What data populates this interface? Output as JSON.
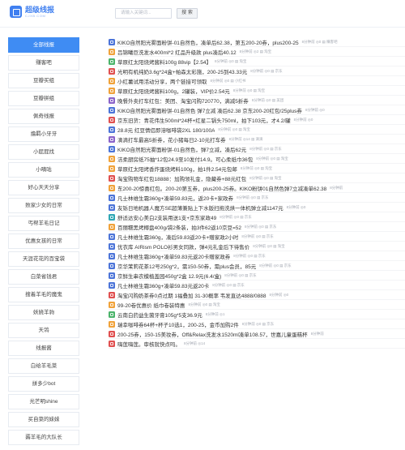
{
  "header": {
    "logo_title": "超级线报",
    "logo_sub": "CJXB.COM",
    "search_placeholder": "请输入关键词...",
    "search_button": "搜 索"
  },
  "sidebar": {
    "items": [
      {
        "label": "全部线报",
        "active": true
      },
      {
        "label": "赚客吧"
      },
      {
        "label": "豆瓣买组"
      },
      {
        "label": "豆瓣拼组"
      },
      {
        "label": "佩奇线报"
      },
      {
        "label": "撸羁小牙牙"
      },
      {
        "label": "小屁屁找"
      },
      {
        "label": "小嘀咕"
      },
      {
        "label": "好心天天分享"
      },
      {
        "label": "败家少女的日常"
      },
      {
        "label": "丐帮羊毛日记"
      },
      {
        "label": "优惠女孩的日常"
      },
      {
        "label": "天涯花花的百宝袋"
      },
      {
        "label": "白菜省钱君"
      },
      {
        "label": "搜着羊毛的魔鬼"
      },
      {
        "label": "妖娆羊驹"
      },
      {
        "label": "天鸰"
      },
      {
        "label": "线报酱"
      },
      {
        "label": "白给羊毛菜"
      },
      {
        "label": "拼多少bot"
      },
      {
        "label": "光芒明shine"
      },
      {
        "label": "买自菜的妹妹"
      },
      {
        "label": "薅羊毛的大队长"
      }
    ]
  },
  "list": [
    {
      "icon": "blue",
      "title": "KIKO自然阳光雾面粉饼-01自然色，凑单后62.38，第五200-20券，plus200-25",
      "meta": "8分钟前  ◎0  ▤ 赚客吧"
    },
    {
      "icon": "orange",
      "title": "吕锦曦巨洗发水400ml*2 红品升级款 plus凑后40.12",
      "meta": "8分钟前  ◎2  ▤ 淘宝"
    },
    {
      "icon": "green",
      "title": "草原红太阳烧烤酱料100g 88vip【2.54】",
      "meta": "8分钟前  ◎0  ▤ 淘宝"
    },
    {
      "icon": "red",
      "title": "光明有机纯奶3.6g*24盒+帕森太彩施，200-25到43.33元",
      "meta": "8分钟前  ◎0  ▤ 京东"
    },
    {
      "icon": "orange",
      "title": "小红薯试用活动分享，两个链接可领取",
      "meta": "8分钟前  ◎0  ▤ 小红书"
    },
    {
      "icon": "orange",
      "title": "草原红太阳烧烤酱料100g，2罐装，VIP价2.54元",
      "meta": "8分钟前  ◎0  ▤ 淘宝"
    },
    {
      "icon": "purple",
      "title": "晚餐外卖打车红包：美团、淘宝闪购720770，满减5折券",
      "meta": "8分钟前  ◎0  ▤ 美团"
    },
    {
      "icon": "blue",
      "title": "KIKO自然阳光雾面粉饼-01自然色 弹7立减 凑后62.38 京东200-20红包/25plus券",
      "meta": "8分钟前  ◎0"
    },
    {
      "icon": "red",
      "title": "京东旧货：青花伟生500ml*24杯+红星二锅头750ml，拍下103元，才4.2/罐",
      "meta": "8分钟前  ◎0"
    },
    {
      "icon": "blue",
      "title": "28.8元 红豆情侣即溶咖啡袋2XL 180/100A",
      "meta": "8分钟前  ◎0  ▤ 淘宝"
    },
    {
      "icon": "purple",
      "title": "滴滴打车最高5折券，花小猪每日2-10元打车券",
      "meta": "8分钟前  ◎14  ▤ 滴滴"
    },
    {
      "icon": "blue",
      "title": "KIKO自然阳光雾面粉饼-01自然色，弹7立减，凑后62元",
      "meta": "8分钟前  ◎0  ▤ 京东"
    },
    {
      "icon": "orange",
      "title": "洁柔厨房纸75抽*12包24.9至10发付14.9。可心柔纸巾36包",
      "meta": "8分钟前  ◎0  ▤ 淘宝"
    },
    {
      "icon": "orange",
      "title": "草原红太阳烤香炸蛋烧烤料100g，拍1件2.54元包邮",
      "meta": "8分钟前  ◎0  ▤ 淘宝"
    },
    {
      "icon": "red",
      "title": "淘宝购物车红包18888：加购领礼金，隐藏券+88元红包",
      "meta": "8分钟前  ◎0  ▤ 淘宝"
    },
    {
      "icon": "orange",
      "title": "东200-20惊喜红包。200-20第五券，plus200-25券。KIKO粉饼01自然色弹7立减凑单62.38",
      "meta": "8分钟前"
    },
    {
      "icon": "blue",
      "title": "凡士林维生霜360g+凑单59.83元，返20卡+家政券",
      "meta": "8分钟前  ◎0  ▤ 京东"
    },
    {
      "icon": "blue",
      "title": "友铄日地机器人魔方SE超薄兼贴上下水版扫拖洗烘一体机弹立减1147元",
      "meta": "8分钟前  ◎0"
    },
    {
      "icon": "teal",
      "title": "舒适达安心美白2支装用送1支+京东家政49",
      "meta": "8分钟前  ◎0  ▤ 京东"
    },
    {
      "icon": "orange",
      "title": "百丽糯黑烤椰盘400g/袋2条装，拍3件62返10京豆=52",
      "meta": "8分钟前  ◎0  ▤ 京东"
    },
    {
      "icon": "blue",
      "title": "凡士林维生霜360g，凑后59.83返20卡+赠家政2小时",
      "meta": "8分钟前  ◎0  ▤ 京东"
    },
    {
      "icon": "blue",
      "title": "优衣库 AIRism POLO衫男女同款，弹4元礼金后下待售价",
      "meta": "8分钟前  ◎0  ▤ 淘宝"
    },
    {
      "icon": "blue",
      "title": "凡士林维生霜360g+凑单59.83元返20卡赠家政券",
      "meta": "8分钟前  ◎0  ▤ 京东"
    },
    {
      "icon": "blue",
      "title": "京华茉莉花茶12号250g*2，需150-50券，需plus会员，85元",
      "meta": "8分钟前  ◎0  ▤ 京东"
    },
    {
      "icon": "blue",
      "title": "京鲜生串农模植盖园450g*2盒 12.9元(6.4/盒)",
      "meta": "8分钟前  ◎0  ▤ 京东"
    },
    {
      "icon": "blue",
      "title": "凡士林维生霜360g+凑单59.83元返20卡",
      "meta": "8分钟前  ◎0  ▤ 京东"
    },
    {
      "icon": "red",
      "title": "淘宝闪购奶茶券0点过期 1福叠加 31-30概率 韦发直达4888/0888",
      "meta": "8分钟前  ◎0"
    },
    {
      "icon": "orange",
      "title": "99-20卷优惠价 纸巾卷装特惠",
      "meta": "8分钟前  ◎0  ▤ 淘宝"
    },
    {
      "icon": "green",
      "title": "云南白药益生菌牙膏105g*5支36.9元",
      "meta": "8分钟前  ◎1"
    },
    {
      "icon": "orange",
      "title": "瑞幸咖啡券64杯+杯子10选1，200-25，金币加购2件",
      "meta": "8分钟前  ◎0  ▤ 京东"
    },
    {
      "icon": "red",
      "title": "200-25券，150-15美妆券，Off&Relax洗发水1520ml凑单108.57，世嘉儿童蛋糕杯",
      "meta": "8分钟前"
    },
    {
      "icon": "red",
      "title": "嗨莲嗨莲。审核就快点吗。",
      "meta": "8分钟前  ◎14"
    }
  ]
}
